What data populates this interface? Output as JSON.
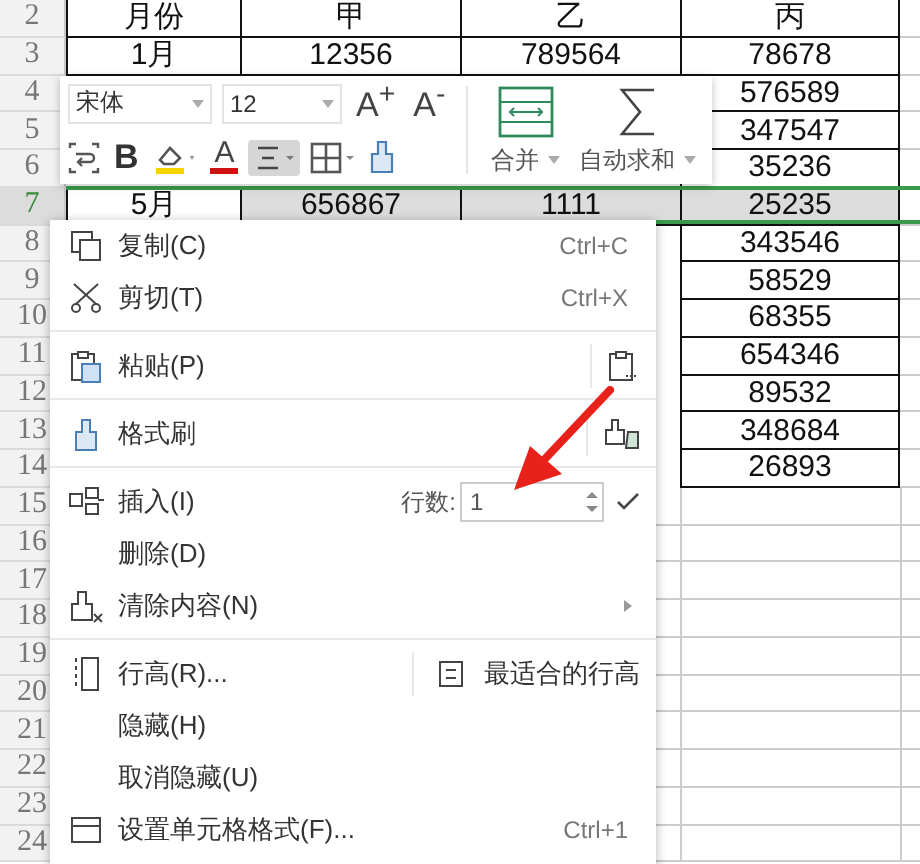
{
  "sheet": {
    "rows": [
      {
        "number": "2",
        "selected": false,
        "cells": [
          "月份",
          "甲",
          "乙",
          "丙"
        ]
      },
      {
        "number": "3",
        "selected": false,
        "cells": [
          "1月",
          "12356",
          "789564",
          "78678"
        ]
      },
      {
        "number": "4",
        "selected": false,
        "cells": [
          null,
          null,
          null,
          "576589"
        ]
      },
      {
        "number": "5",
        "selected": false,
        "cells": [
          null,
          null,
          null,
          "347547"
        ]
      },
      {
        "number": "6",
        "selected": false,
        "cells": [
          null,
          null,
          null,
          "35236"
        ]
      },
      {
        "number": "7",
        "selected": true,
        "cells": [
          "5月",
          "656867",
          "1111",
          "25235"
        ]
      },
      {
        "number": "8",
        "selected": false,
        "cells": [
          null,
          null,
          null,
          "343546"
        ]
      },
      {
        "number": "9",
        "selected": false,
        "cells": [
          null,
          null,
          null,
          "58529"
        ]
      },
      {
        "number": "10",
        "selected": false,
        "cells": [
          null,
          null,
          null,
          "68355"
        ]
      },
      {
        "number": "11",
        "selected": false,
        "cells": [
          null,
          null,
          null,
          "654346"
        ]
      },
      {
        "number": "12",
        "selected": false,
        "cells": [
          null,
          null,
          null,
          "89532"
        ]
      },
      {
        "number": "13",
        "selected": false,
        "cells": [
          null,
          null,
          null,
          "348684"
        ]
      },
      {
        "number": "14",
        "selected": false,
        "cells": [
          null,
          null,
          null,
          "26893"
        ]
      },
      {
        "number": "15",
        "selected": false
      },
      {
        "number": "16",
        "selected": false
      },
      {
        "number": "17",
        "selected": false
      },
      {
        "number": "18",
        "selected": false
      },
      {
        "number": "19",
        "selected": false
      },
      {
        "number": "20",
        "selected": false
      },
      {
        "number": "21",
        "selected": false
      },
      {
        "number": "22",
        "selected": false
      },
      {
        "number": "23",
        "selected": false
      },
      {
        "number": "24",
        "selected": false
      }
    ]
  },
  "toolbar": {
    "font": "宋体",
    "size": "12",
    "grow": "A$^{+}$",
    "shrink": "A$^{-}$",
    "bold": "B",
    "font_color": "A",
    "align_selected": true,
    "merge": "合并",
    "autosum": "自动求和"
  },
  "context_menu": [
    {
      "kind": "item",
      "label": "复制(C)",
      "shortcut": "Ctrl+C"
    },
    {
      "kind": "item",
      "label": "剪切(T)",
      "shortcut": "Ctrl+X"
    },
    {
      "kind": "separator"
    },
    {
      "kind": "item",
      "label": "粘贴(P)",
      "side_icon": true
    },
    {
      "kind": "separator"
    },
    {
      "kind": "item",
      "label": "格式刷",
      "side_icon": true
    },
    {
      "kind": "separator"
    },
    {
      "kind": "item",
      "label": "插入(I)",
      "field_label": "行数:",
      "field_value": "1"
    },
    {
      "kind": "item",
      "label": "删除(D)"
    },
    {
      "kind": "item",
      "label": "清除内容(N)",
      "submenu": true
    },
    {
      "kind": "separator"
    },
    {
      "kind": "item",
      "label": "行高(R)...",
      "side_label": "最适合的行高"
    },
    {
      "kind": "item",
      "label": "隐藏(H)"
    },
    {
      "kind": "item",
      "label": "取消隐藏(U)"
    },
    {
      "kind": "item",
      "label": "设置单元格格式(F)...",
      "shortcut": "Ctrl+1"
    }
  ]
}
